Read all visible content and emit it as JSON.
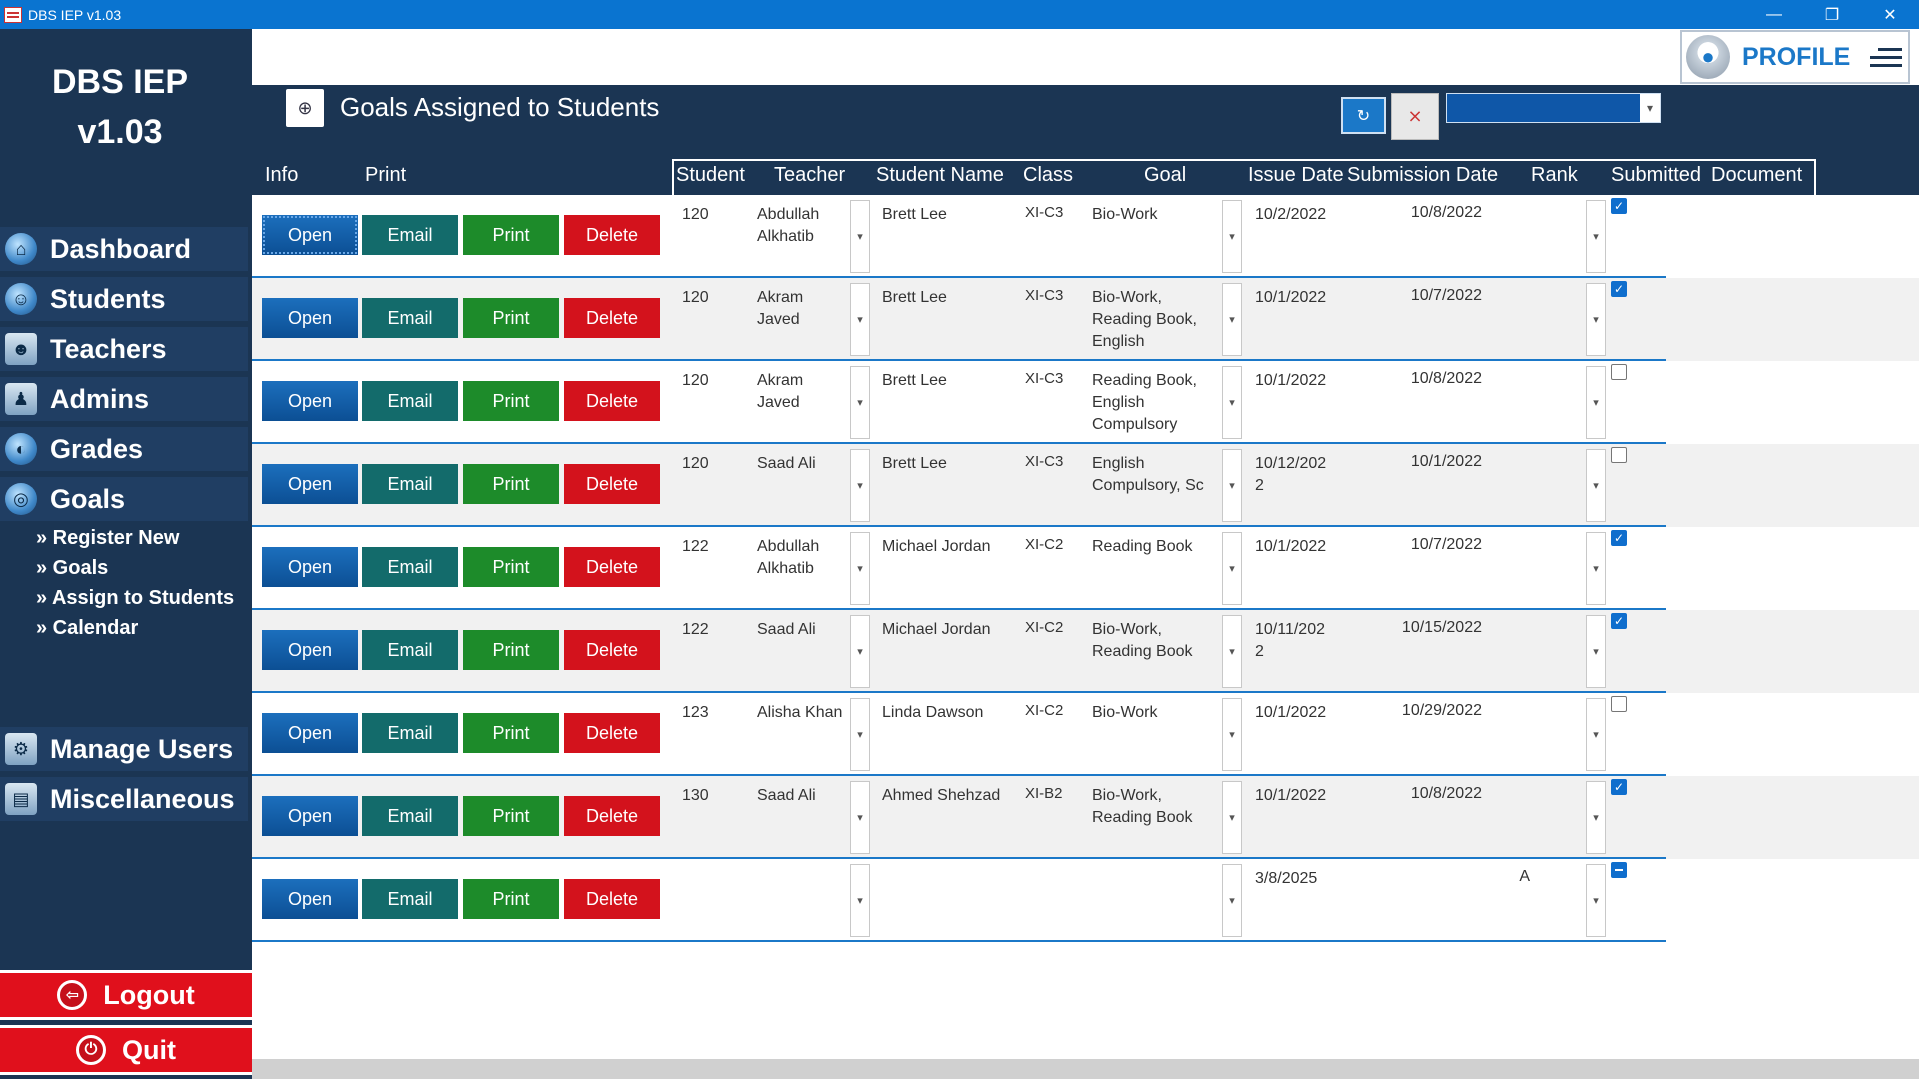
{
  "window": {
    "title": "DBS IEP v1.03",
    "min": "—",
    "max": "❐",
    "close": "✕"
  },
  "sidebar": {
    "brand_line1": "DBS IEP",
    "brand_line2": "v1.03",
    "items": [
      {
        "label": "Dashboard",
        "icon": "home-icon"
      },
      {
        "label": "Students",
        "icon": "students-icon"
      },
      {
        "label": "Teachers",
        "icon": "teacher-icon"
      },
      {
        "label": "Admins",
        "icon": "admin-icon"
      },
      {
        "label": "Grades",
        "icon": "grades-icon"
      },
      {
        "label": "Goals",
        "icon": "target-icon"
      }
    ],
    "sub_items": [
      "» Register New",
      "» Goals",
      "» Assign to Students",
      "» Calendar"
    ],
    "manage_users": "Manage Users",
    "misc": "Miscellaneous",
    "logout": "Logout",
    "quit": "Quit"
  },
  "profile": {
    "label": "PROFILE"
  },
  "page": {
    "title": "Goals Assigned to Students"
  },
  "columns": {
    "info": "Info",
    "print": "Print",
    "student": "Student",
    "teacher": "Teacher",
    "student_name": "Student Name",
    "class": "Class",
    "goal": "Goal",
    "issue_date": "Issue Date",
    "submission_date": "Submission Date",
    "rank": "Rank",
    "submitted": "Submitted",
    "document": "Document"
  },
  "buttons": {
    "open": "Open",
    "email": "Email",
    "print": "Print",
    "delete": "Delete"
  },
  "rows": [
    {
      "student": "120",
      "teacher": "Abdullah\nAlkhatib",
      "name": "Brett Lee",
      "class": "XI-C3",
      "goal": "Bio-Work",
      "issue": "10/2/2022",
      "submission": "10/8/2022",
      "rank": "",
      "submitted": "checked"
    },
    {
      "student": "120",
      "teacher": "Akram\nJaved",
      "name": "Brett Lee",
      "class": "XI-C3",
      "goal": "Bio-Work,\nReading Book,\nEnglish",
      "issue": "10/1/2022",
      "submission": "10/7/2022",
      "rank": "",
      "submitted": "checked"
    },
    {
      "student": "120",
      "teacher": "Akram\nJaved",
      "name": "Brett Lee",
      "class": "XI-C3",
      "goal": "Reading Book,\nEnglish\nCompulsory",
      "issue": "10/1/2022",
      "submission": "10/8/2022",
      "rank": "",
      "submitted": "unchecked"
    },
    {
      "student": "120",
      "teacher": "Saad Ali",
      "name": "Brett Lee",
      "class": "XI-C3",
      "goal": "English\nCompulsory, Sc",
      "issue": "10/12/202\n2",
      "submission": "10/1/2022",
      "rank": "",
      "submitted": "unchecked"
    },
    {
      "student": "122",
      "teacher": "Abdullah\nAlkhatib",
      "name": "Michael Jordan",
      "class": "XI-C2",
      "goal": "Reading Book",
      "issue": "10/1/2022",
      "submission": "10/7/2022",
      "rank": "",
      "submitted": "checked"
    },
    {
      "student": "122",
      "teacher": "Saad Ali",
      "name": "Michael Jordan",
      "class": "XI-C2",
      "goal": "Bio-Work,\nReading Book",
      "issue": "10/11/202\n2",
      "submission": "10/15/2022",
      "rank": "",
      "submitted": "checked"
    },
    {
      "student": "123",
      "teacher": "Alisha Khan",
      "name": "Linda Dawson",
      "class": "XI-C2",
      "goal": "Bio-Work",
      "issue": "10/1/2022",
      "submission": "10/29/2022",
      "rank": "",
      "submitted": "unchecked"
    },
    {
      "student": "130",
      "teacher": "Saad Ali",
      "name": "Ahmed Shehzad",
      "class": "XI-B2",
      "goal": "Bio-Work,\nReading Book",
      "issue": "10/1/2022",
      "submission": "10/8/2022",
      "rank": "",
      "submitted": "checked"
    },
    {
      "student": "",
      "teacher": "",
      "name": "",
      "class": "",
      "goal": "",
      "issue": "3/8/2025",
      "submission": "",
      "rank": "A",
      "submitted": "indeterminate"
    }
  ],
  "colors": {
    "sidebar": "#1b3553",
    "accent": "#0a74d0",
    "open": "#0c4f94",
    "email": "#136b6b",
    "print": "#1d8b2a",
    "delete": "#d3121c"
  }
}
